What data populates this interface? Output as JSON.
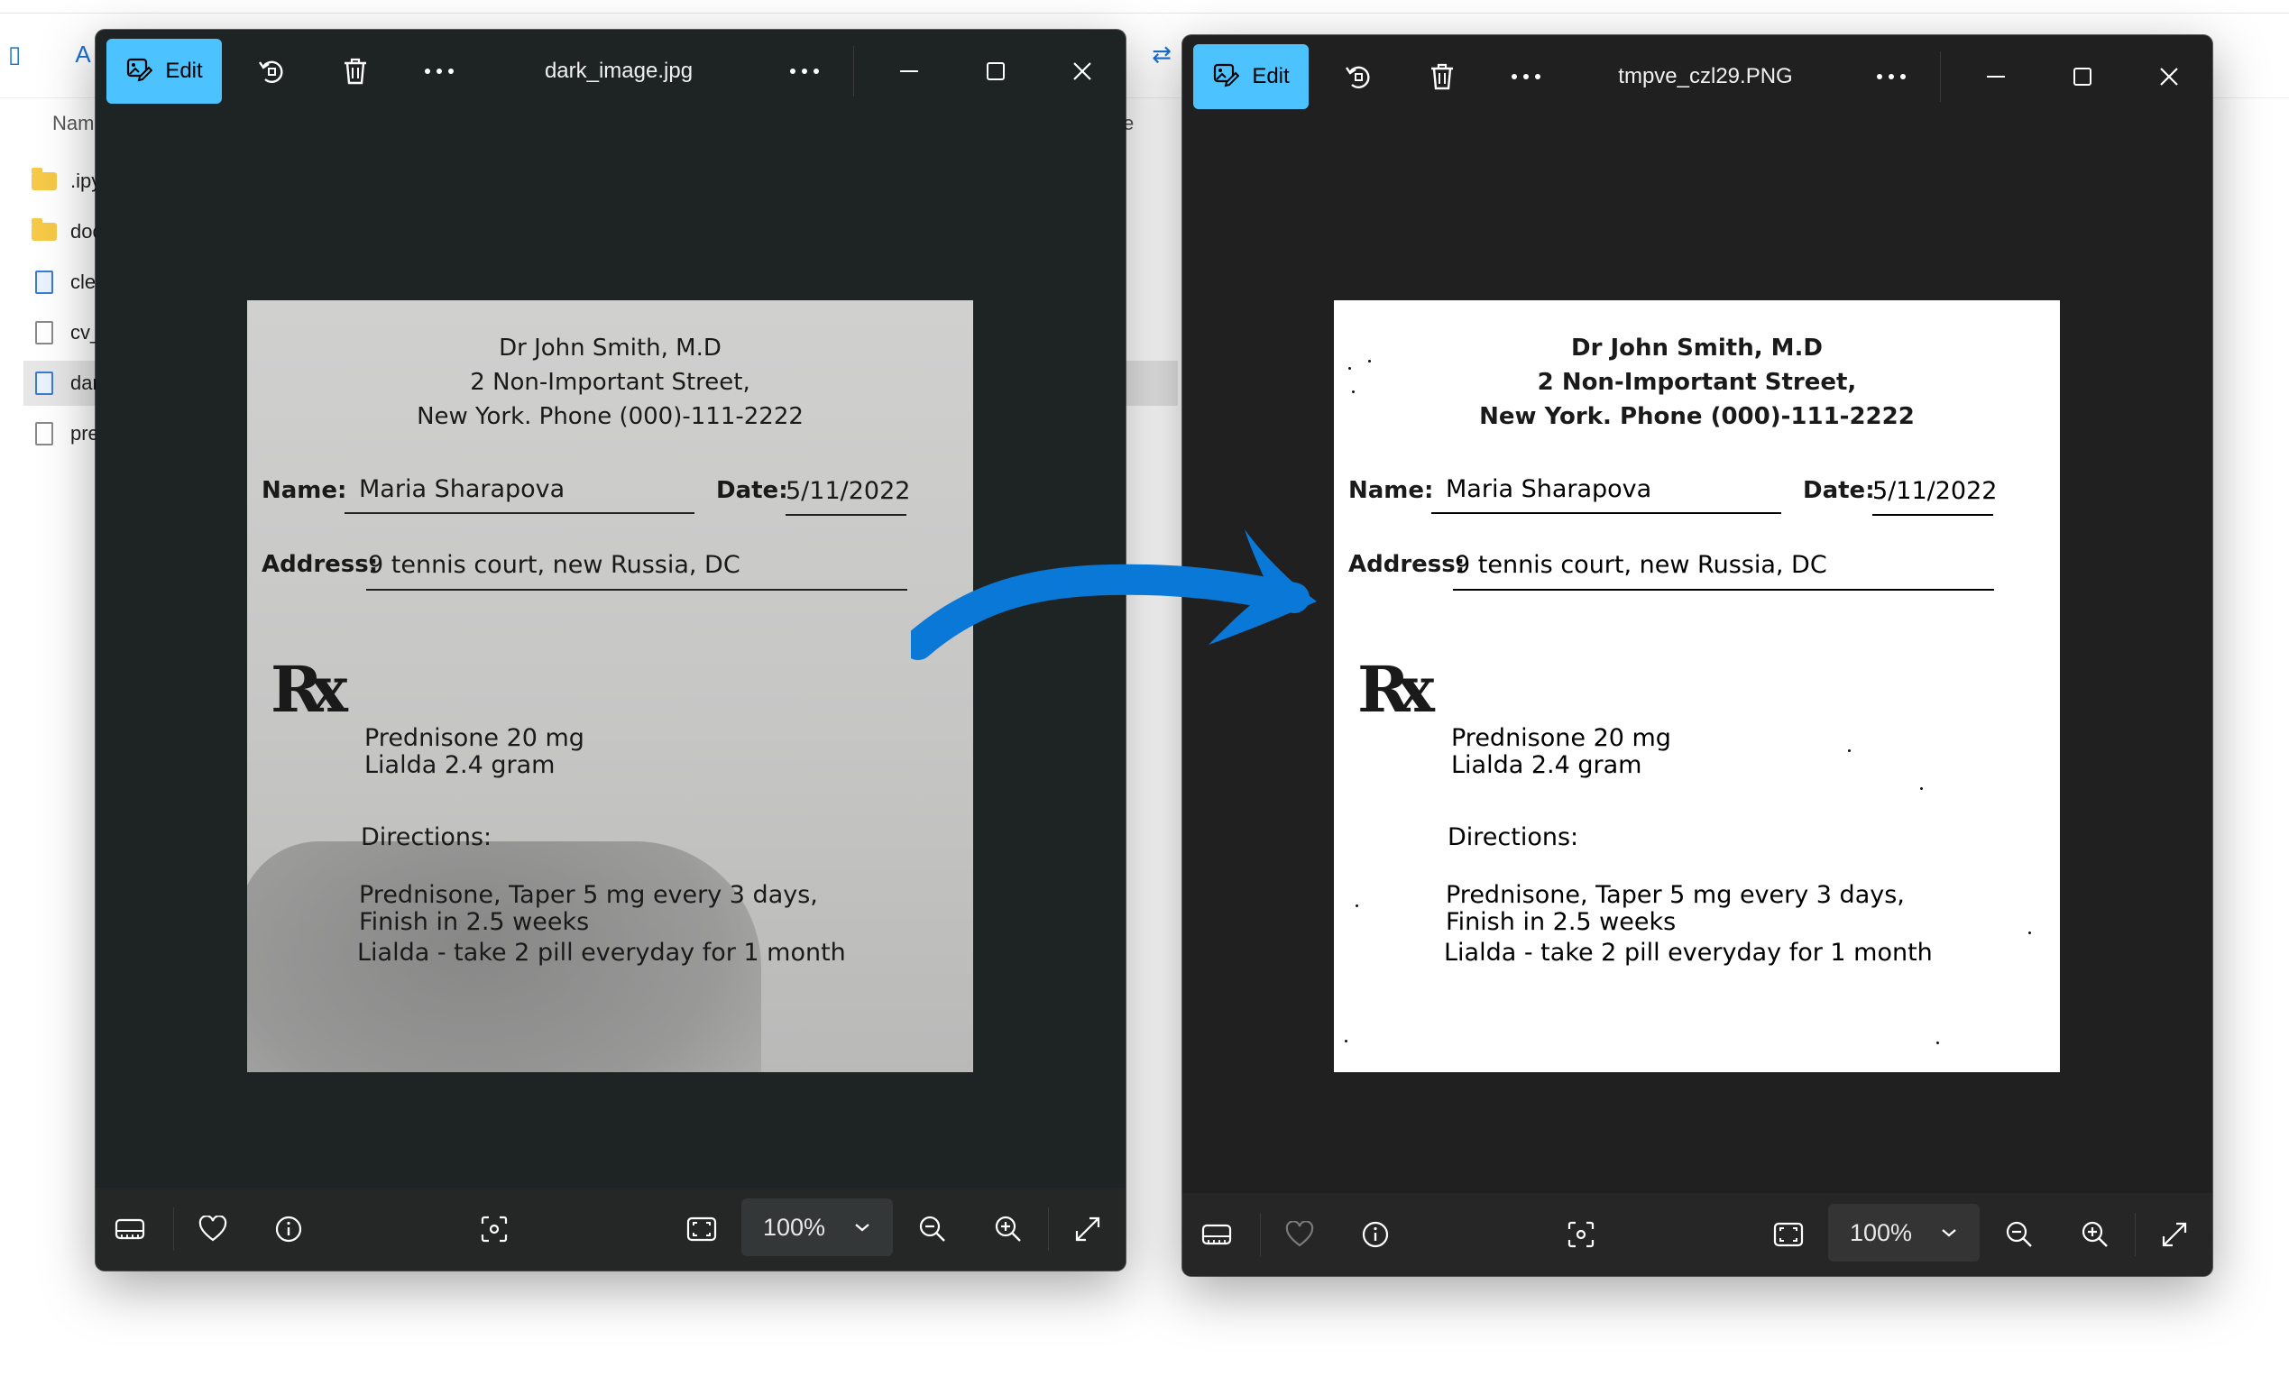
{
  "explorer": {
    "column_header": "Nam",
    "column_header_right": "e",
    "rows": [
      {
        "label": ".ipy",
        "type": "folder"
      },
      {
        "label": "doc",
        "type": "folder"
      },
      {
        "label": "cle",
        "type": "image"
      },
      {
        "label": "cv_",
        "type": "file"
      },
      {
        "label": "dar",
        "type": "image",
        "selected": true
      },
      {
        "label": "pre",
        "type": "file"
      }
    ]
  },
  "left_viewer": {
    "edit_label": "Edit",
    "filename": "dark_image.jpg",
    "zoom": "100%"
  },
  "right_viewer": {
    "edit_label": "Edit",
    "filename": "tmpve_czl29.PNG",
    "zoom": "100%"
  },
  "prescription": {
    "doctor": "Dr John Smith, M.D",
    "street": "2 Non-Important Street,",
    "city_phone": "New York. Phone (000)-111-2222",
    "name_label": "Name:",
    "name_value": "Maria Sharapova",
    "date_label": "Date:",
    "date_value": "5/11/2022",
    "address_label": "Address:",
    "address_value": "9 tennis court, new Russia, DC",
    "rx_symbol": "Rx",
    "med1": "Prednisone 20 mg",
    "med2": "Lialda 2.4 gram",
    "directions_label": "Directions:",
    "dir1": "Prednisone, Taper 5 mg every 3 days,",
    "dir2": "Finish in 2.5 weeks",
    "dir3": "Lialda - take 2 pill everyday for 1 month"
  },
  "colors": {
    "edit_accent": "#4cc2ff",
    "arrow": "#0a78d7",
    "viewer_bg": "#1f2222"
  }
}
